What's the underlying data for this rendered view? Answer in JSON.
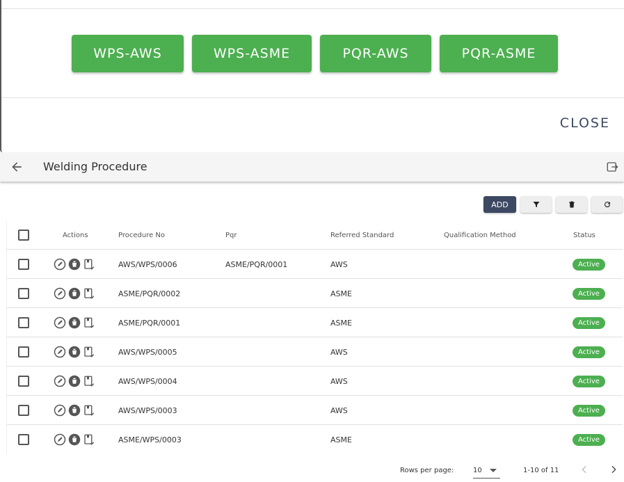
{
  "dialog": {
    "buttons": [
      "WPS-AWS",
      "WPS-ASME",
      "PQR-AWS",
      "PQR-ASME"
    ],
    "close_label": "CLOSE"
  },
  "appbar": {
    "title": "Welding Procedure",
    "back_icon": "arrow-left-icon",
    "export_icon": "exit-icon"
  },
  "toolbar": {
    "add_label": "ADD",
    "filter_icon": "filter-icon",
    "delete_icon": "trash-icon",
    "refresh_icon": "refresh-icon"
  },
  "table": {
    "headers": {
      "actions": "Actions",
      "procedure_no": "Procedure No",
      "pqr": "Pqr",
      "referred_standard": "Referred Standard",
      "qualification_method": "Qualification Method",
      "status": "Status"
    },
    "rows": [
      {
        "procedure_no": "AWS/WPS/0006",
        "pqr": "ASME/PQR/0001",
        "referred_standard": "AWS",
        "qualification_method": "",
        "status": "Active"
      },
      {
        "procedure_no": "ASME/PQR/0002",
        "pqr": "",
        "referred_standard": "ASME",
        "qualification_method": "",
        "status": "Active"
      },
      {
        "procedure_no": "ASME/PQR/0001",
        "pqr": "",
        "referred_standard": "ASME",
        "qualification_method": "",
        "status": "Active"
      },
      {
        "procedure_no": "AWS/WPS/0005",
        "pqr": "",
        "referred_standard": "AWS",
        "qualification_method": "",
        "status": "Active"
      },
      {
        "procedure_no": "AWS/WPS/0004",
        "pqr": "",
        "referred_standard": "AWS",
        "qualification_method": "",
        "status": "Active"
      },
      {
        "procedure_no": "AWS/WPS/0003",
        "pqr": "",
        "referred_standard": "AWS",
        "qualification_method": "",
        "status": "Active"
      },
      {
        "procedure_no": "ASME/WPS/0003",
        "pqr": "",
        "referred_standard": "ASME",
        "qualification_method": "",
        "status": "Active"
      }
    ]
  },
  "pagination": {
    "rows_per_page_label": "Rows per page:",
    "rows_per_page_value": "10",
    "range_text": "1-10 of 11"
  },
  "colors": {
    "primary_green": "#4caf50",
    "navy": "#3d4863"
  }
}
